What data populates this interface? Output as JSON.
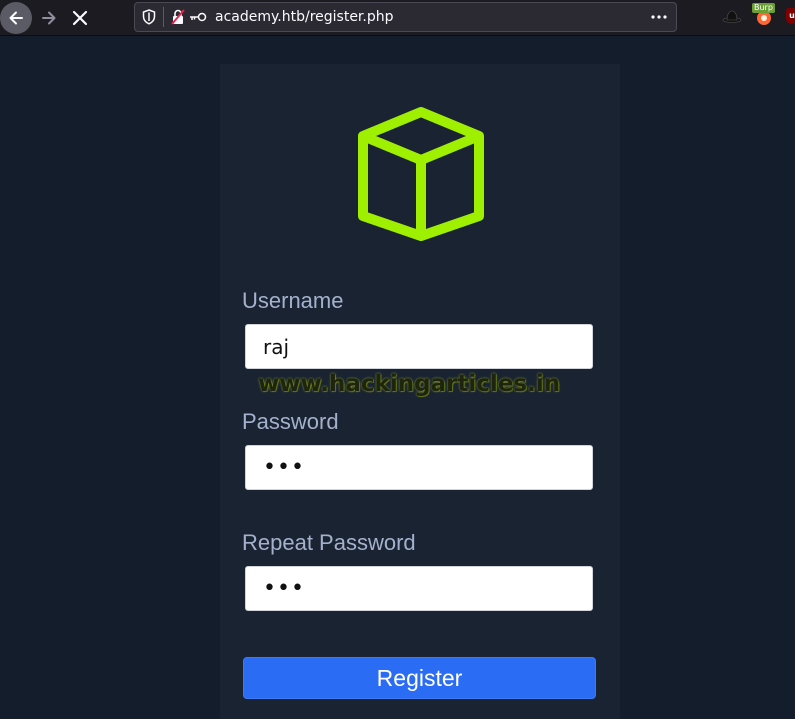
{
  "browser": {
    "url": "academy.htb/register.php",
    "extension_badge": "Burp",
    "ublock_label": "u"
  },
  "form": {
    "username_label": "Username",
    "username_value": "raj",
    "password_label": "Password",
    "password_value": "•••",
    "repeat_label": "Repeat Password",
    "repeat_value": "•••",
    "submit_label": "Register"
  },
  "watermark": "www.hackingarticles.in",
  "colors": {
    "page_bg": "#141d2b",
    "card_bg": "#1a2332",
    "logo_green": "#9fef00",
    "button_blue": "#2a6cf4",
    "label_color": "#a4b1cd"
  },
  "icons": [
    "back-arrow-icon",
    "forward-arrow-icon",
    "stop-icon",
    "shield-icon",
    "insecure-lock-icon",
    "key-icon",
    "more-icon",
    "hat-icon",
    "burp-icon",
    "ublock-icon",
    "cube-logo-icon"
  ]
}
